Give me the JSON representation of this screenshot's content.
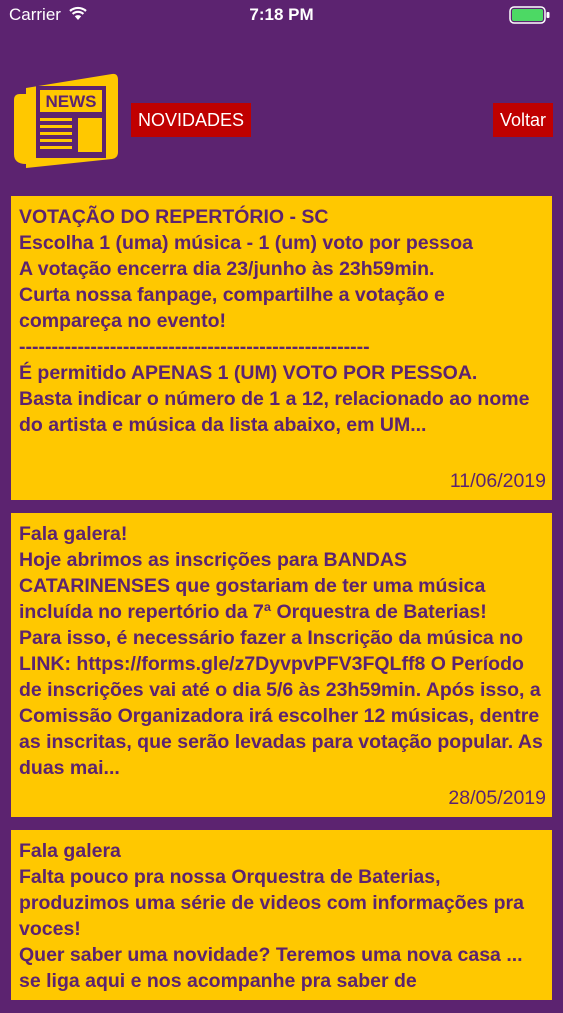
{
  "status_bar": {
    "carrier": "Carrier",
    "time": "7:18 PM"
  },
  "header": {
    "logo_text": "NEWS",
    "novidades_label": "NOVIDADES",
    "voltar_label": "Voltar"
  },
  "colors": {
    "background": "#5c2370",
    "card": "#ffc800",
    "button": "#c00000"
  },
  "posts": [
    {
      "text": "VOTAÇÃO DO REPERTÓRIO - SC\nEscolha 1 (uma) música - 1 (um) voto por pessoa\nA votação encerra dia 23/junho às 23h59min.\nCurta nossa fanpage, compartilhe a votação e compareça no evento!\n------------------------------------------------------\nÉ permitido APENAS 1 (UM) VOTO POR PESSOA.\nBasta indicar o número de 1 a 12, relacionado ao nome do artista e música da lista abaixo, em UM...",
      "date": "11/06/2019"
    },
    {
      "text": "Fala galera!\nHoje abrimos as inscrições para BANDAS CATARINENSES que gostariam de ter uma música incluída no repertório da 7ª Orquestra de Baterias!\nPara isso, é necessário fazer a Inscrição da música no LINK: https://forms.gle/z7DyvpvPFV3FQLff8 O Período de inscrições vai até o dia 5/6 às 23h59min. Após isso, a Comissão Organizadora irá escolher 12 músicas, dentre as inscritas, que serão levadas para votação popular. As duas mai...",
      "date": "28/05/2019"
    },
    {
      "text": "Fala galera\nFalta pouco pra nossa Orquestra de Baterias, produzimos uma série de videos com informações pra voces!\nQuer saber uma novidade? Teremos uma nova casa ... se liga aqui e nos acompanhe pra saber de",
      "date": ""
    }
  ]
}
